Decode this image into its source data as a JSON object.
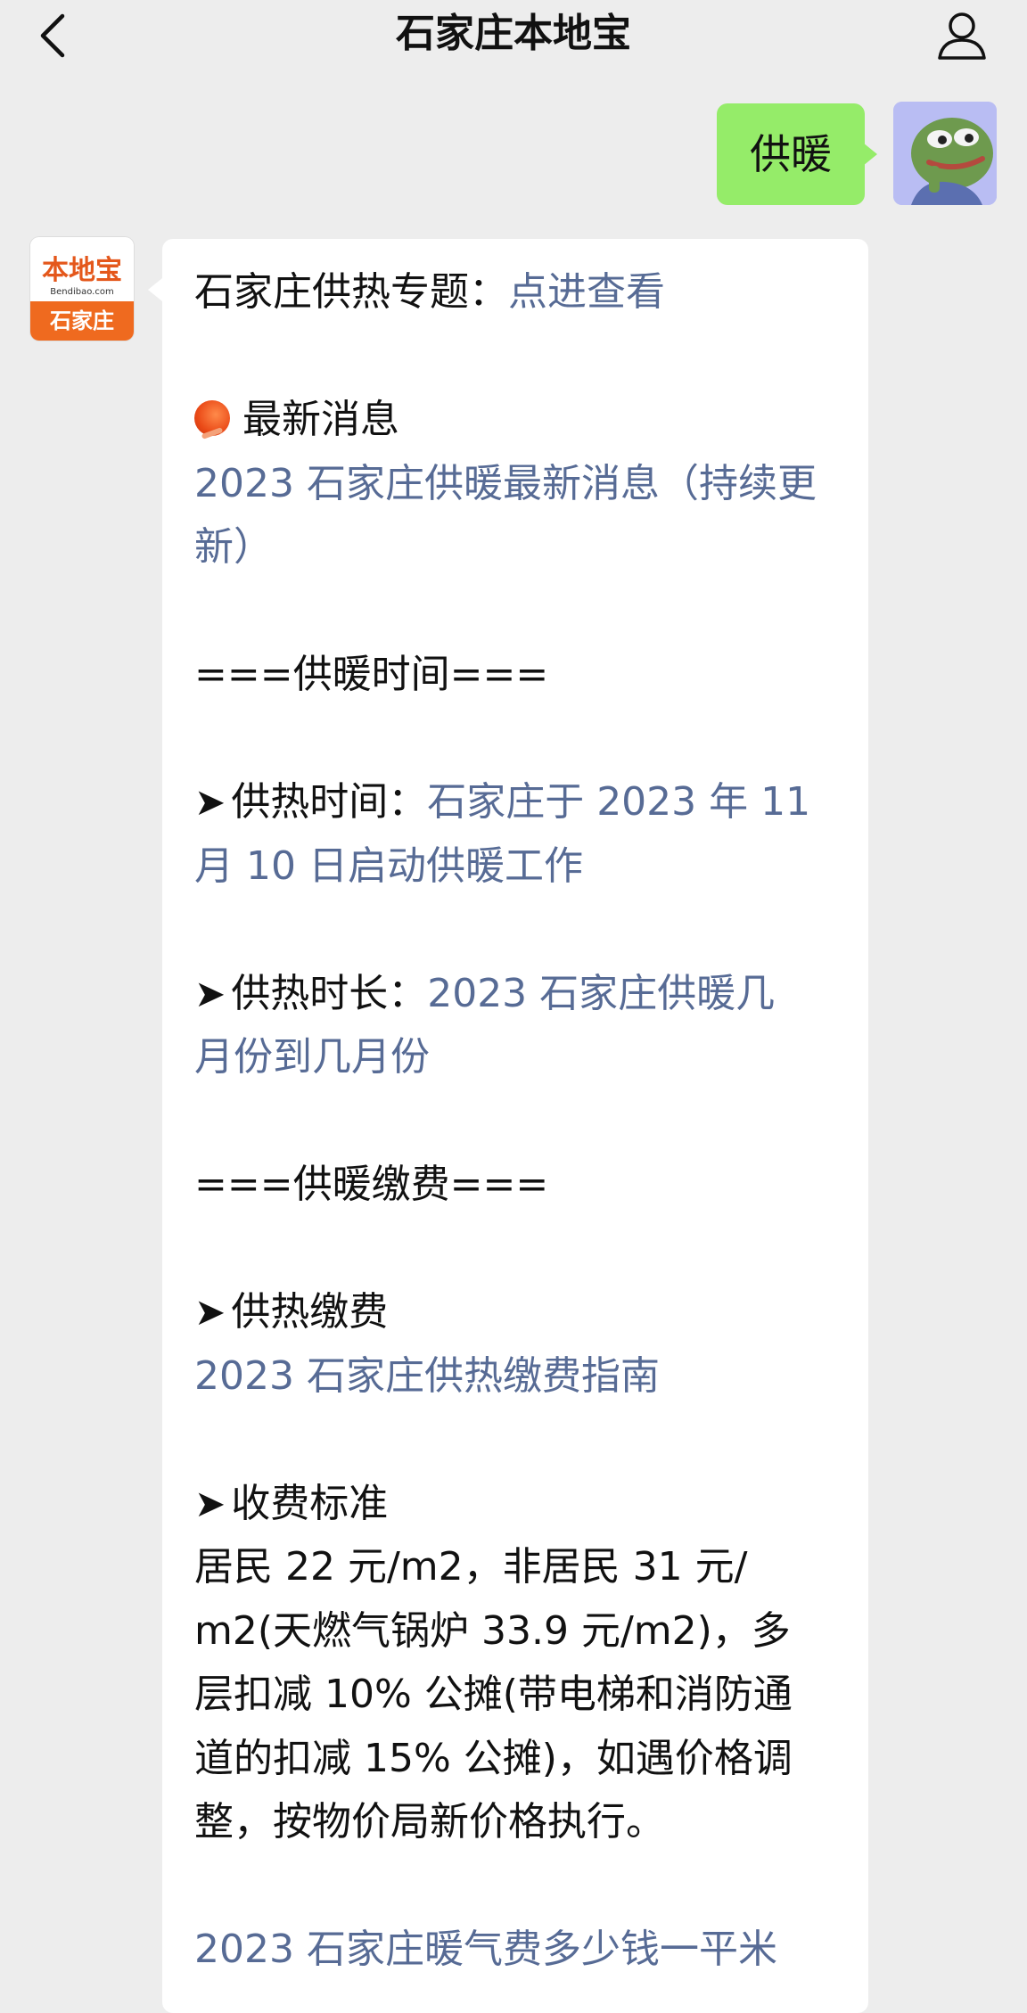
{
  "header": {
    "title": "石家庄本地宝"
  },
  "outgoing_message": {
    "text": "供暖"
  },
  "bot": {
    "avatar_logo_main": "本地宝",
    "avatar_logo_url": "Bendibao.com",
    "avatar_logo_city": "石家庄"
  },
  "message": {
    "topic_label": "石家庄供热专题：",
    "topic_link": "点进查看",
    "news_heading": "最新消息",
    "news_link_line1": "2023 石家庄供暖最新消息（持续更",
    "news_link_line2": "新）",
    "section_time": "===供暖时间===",
    "start_label": "供热时间：",
    "start_link_line1": "石家庄于 2023 年 11",
    "start_link_line2": "月 10 日启动供暖工作",
    "duration_label": "供热时长：",
    "duration_link_line1": "2023 石家庄供暖几",
    "duration_link_line2": "月份到几月份",
    "section_fee": "===供暖缴费===",
    "pay_label": "供热缴费",
    "pay_link": "2023 石家庄供热缴费指南",
    "standard_label": "收费标准",
    "standard_lines": [
      "居民 22 元/m2，非居民 31 元/",
      "m2(天燃气锅炉 33.9 元/m2)，多",
      "层扣减 10% 公摊(带电梯和消防通",
      "道的扣减 15% 公摊)，如遇价格调",
      "整，按物价局新价格执行。"
    ],
    "price_link": "2023 石家庄暖气费多少钱一平米",
    "arrow_glyph": "➤"
  }
}
